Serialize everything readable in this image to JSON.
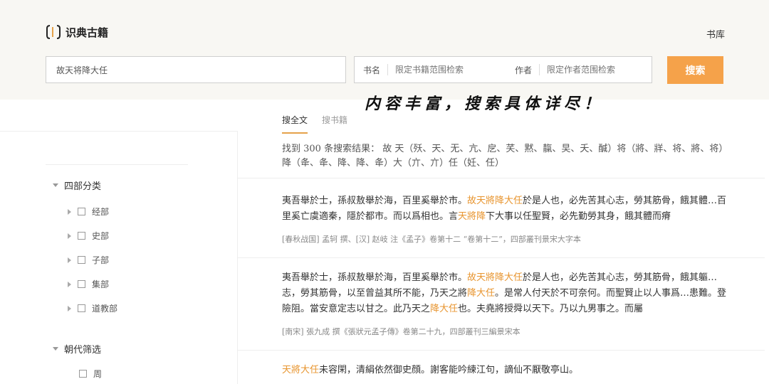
{
  "app": {
    "name": "识典古籍"
  },
  "nav": {
    "library": "书库"
  },
  "search": {
    "query": "故天将降大任",
    "book_label": "书名",
    "book_placeholder": "限定书籍范围检索",
    "author_label": "作者",
    "author_placeholder": "限定作者范围检索",
    "button": "搜索"
  },
  "overlay": {
    "caption": "内容丰富，搜索具体详尽！"
  },
  "tabs": [
    {
      "label": "搜全文",
      "active": true
    },
    {
      "label": "搜书籍",
      "active": false
    }
  ],
  "sidebar": {
    "section1": {
      "title": "四部分类",
      "items": [
        "经部",
        "史部",
        "子部",
        "集部",
        "道教部"
      ]
    },
    "section2": {
      "title": "朝代筛选",
      "items": [
        "周"
      ]
    }
  },
  "summary": {
    "text": "找到 300 条搜索结果：  故 天（殀、天、无、亢、戹、芺、黙、靝、旲、夭、醎）将（將、牂、将、將、将）降（夅、夅、降、降、夅）大（亣、亣）任（妊、任）"
  },
  "results": [
    {
      "segments": [
        {
          "t": "夷吾舉於士，孫叔敖舉於海，百里奚舉於市。",
          "hl": false
        },
        {
          "t": "故天將降大任",
          "hl": true
        },
        {
          "t": "於是人也，必先苦其心志，勞其筋骨，餓其體…百里奚亡虞適秦，隱於都市。而以爲相也。言",
          "hl": false
        },
        {
          "t": "天將降",
          "hl": true
        },
        {
          "t": "下大事以任聖賢，必先勤勞其身，餓其體而瘠",
          "hl": false
        }
      ],
      "meta": "[春秋战国] 孟轲 撰、[汉] 赵岐 注《孟子》卷第十二 “卷第十二”，四部叢刊景宋大字本"
    },
    {
      "segments": [
        {
          "t": "夷吾舉於士，孫叔敖舉於海，百里奚舉於市。",
          "hl": false
        },
        {
          "t": "故天將降大任",
          "hl": true
        },
        {
          "t": "於是人也，必先苦其心志，勞其筋骨，餓其軀…志，勞其筋骨，以至曾益其所不能，乃天之將",
          "hl": false
        },
        {
          "t": "降大任",
          "hl": true
        },
        {
          "t": "。是常人付天於不可奈何。而聖賢止以人事爲…患難。登險阻。當安意定志以甘之。此乃天之",
          "hl": false
        },
        {
          "t": "降大任",
          "hl": true
        },
        {
          "t": "也。夫堯將授舜以天下。乃以九男事之。而屬",
          "hl": false
        }
      ],
      "meta": "[南宋] 張九成 撰《張狀元孟子傳》卷第二十九，四部叢刊三編景宋本"
    },
    {
      "segments": [
        {
          "t": "天將大任",
          "hl": true
        },
        {
          "t": "未容閑，清絹依然御史顔。謝客能吟練江句，謫仙不厭敬亭山。",
          "hl": false
        }
      ],
      "meta": ""
    }
  ],
  "colors": {
    "accent": "#f5a24a",
    "highlight": "#e8952f",
    "header_bg": "#f8f7f3"
  },
  "icons": {
    "logo": "bracket-book-icon",
    "caret": "caret-icon",
    "checkbox": "checkbox-icon"
  }
}
